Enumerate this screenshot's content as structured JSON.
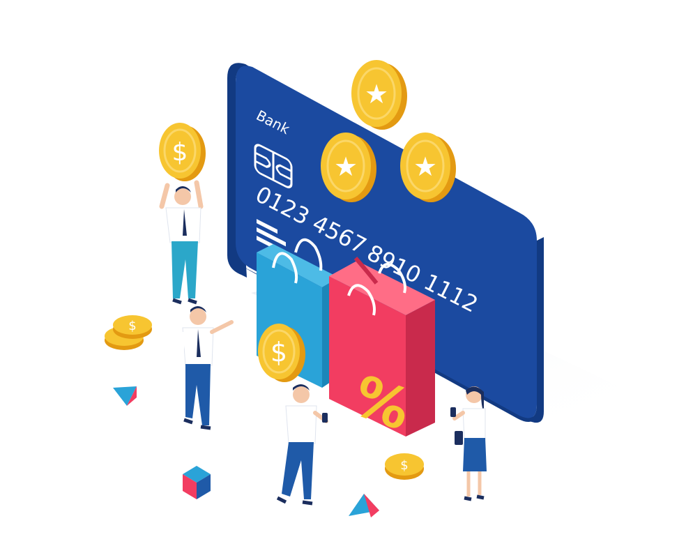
{
  "card": {
    "bank_label": "Bank",
    "number_line1": "0123  4567",
    "number_line2": "8910  1112"
  },
  "coins": {
    "dollar_glyph": "$",
    "star_glyph": "★"
  },
  "bag": {
    "discount_glyph": "%"
  },
  "colors": {
    "card_face": "#1b4aa0",
    "card_side": "#123a82",
    "coin_face": "#f7c531",
    "coin_edge": "#e39a12",
    "bag_blue": "#2aa3d8",
    "bag_red": "#f23d61",
    "shirt": "#ffffff",
    "pants_blue": "#1f5aa8",
    "pants_teal": "#2ba7c9"
  }
}
